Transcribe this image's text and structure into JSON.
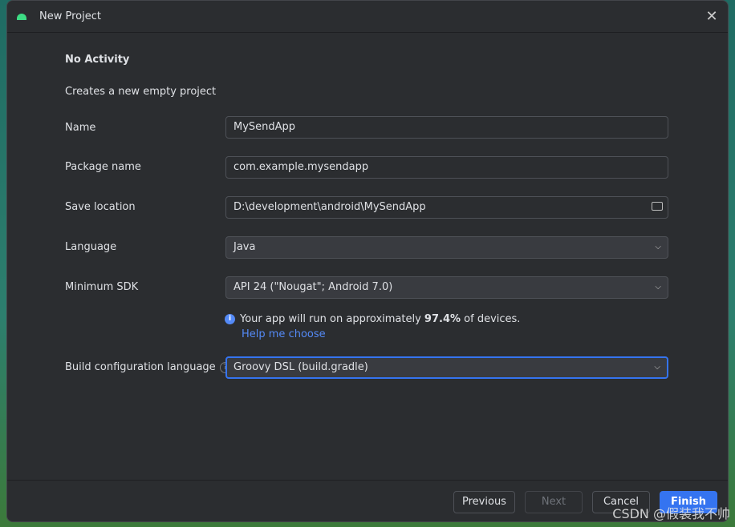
{
  "window": {
    "title": "New Project",
    "icon": "android-icon"
  },
  "header": {
    "title": "No Activity",
    "subtitle": "Creates a new empty project"
  },
  "form": {
    "name": {
      "label": "Name",
      "value": "MySendApp"
    },
    "package": {
      "label": "Package name",
      "value": "com.example.mysendapp"
    },
    "location": {
      "label": "Save location",
      "value": "D:\\development\\android\\MySendApp"
    },
    "language": {
      "label": "Language",
      "value": "Java"
    },
    "min_sdk": {
      "label": "Minimum SDK",
      "value": "API 24 (\"Nougat\"; Android 7.0)"
    },
    "info": {
      "prefix": "Your app will run on approximately ",
      "percent": "97.4%",
      "suffix": " of devices.",
      "link": "Help me choose"
    },
    "build_lang": {
      "label": "Build configuration language",
      "value": "Groovy DSL (build.gradle)",
      "help": "?"
    }
  },
  "footer": {
    "previous": "Previous",
    "next": "Next",
    "cancel": "Cancel",
    "finish": "Finish"
  },
  "watermark": "CSDN @假装我不帅",
  "colors": {
    "accent": "#3574f0",
    "link": "#548af7",
    "bg": "#2b2d30"
  }
}
